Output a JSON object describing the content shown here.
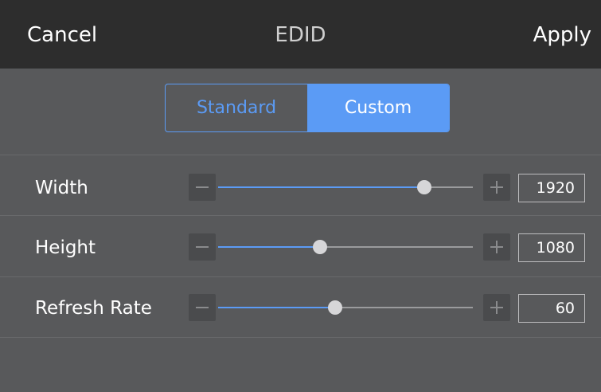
{
  "header": {
    "cancel_label": "Cancel",
    "title": "EDID",
    "apply_label": "Apply"
  },
  "mode_toggle": {
    "options": [
      "Standard",
      "Custom"
    ],
    "selected": "Custom"
  },
  "settings": [
    {
      "label": "Width",
      "value": "1920",
      "level": 0.81
    },
    {
      "label": "Height",
      "value": "1080",
      "level": 0.4
    },
    {
      "label": "Refresh Rate",
      "value": "60",
      "level": 0.46
    }
  ],
  "colors": {
    "accent": "#5b9bf5",
    "header_bg": "#2d2d2d",
    "panel_bg": "#58595b",
    "button_bg": "#4a4b4d"
  },
  "icons": {
    "decrement": "minus-icon",
    "increment": "plus-icon"
  }
}
